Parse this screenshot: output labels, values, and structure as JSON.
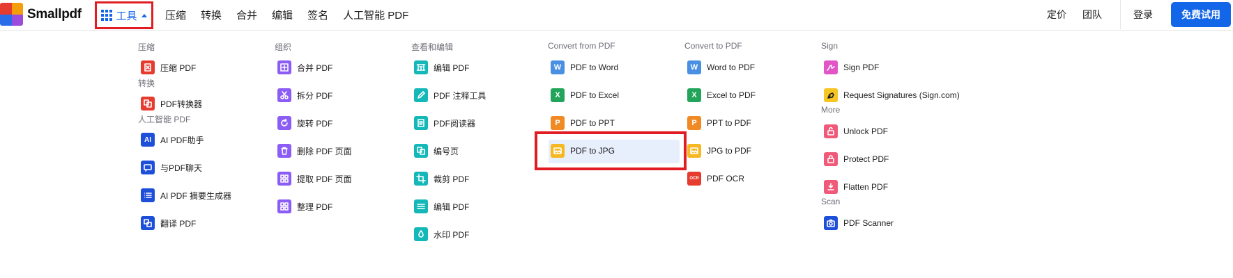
{
  "brand": {
    "name": "Smallpdf",
    "colors": [
      "#e53c2f",
      "#f59e0b",
      "#22a55a",
      "#2b6de8",
      "#9a4cdc"
    ]
  },
  "header": {
    "tools_label": "工具",
    "nav": [
      "压缩",
      "转换",
      "合并",
      "编辑",
      "签名",
      "人工智能 PDF"
    ],
    "pricing": "定价",
    "team": "团队",
    "login": "登录",
    "trial": "免费试用",
    "accent": "#1466e8"
  },
  "menu": {
    "columns": [
      {
        "sections": [
          {
            "title": "压缩",
            "items": [
              {
                "label": "压缩 PDF",
                "icon": "compress-icon",
                "color": "#e53c2f"
              }
            ]
          },
          {
            "title": "转换",
            "items": [
              {
                "label": "PDF转换器",
                "icon": "converter-icon",
                "color": "#e53c2f"
              }
            ]
          },
          {
            "title": "人工智能 PDF",
            "items": [
              {
                "label": "AI PDF助手",
                "icon": "ai-icon",
                "color": "#1d4fd8",
                "glyph": "AI"
              },
              {
                "label": "与PDF聊天",
                "icon": "chat-icon",
                "color": "#1d4fd8"
              },
              {
                "label": "AI PDF 摘要生成器",
                "icon": "list-icon",
                "color": "#1d4fd8"
              },
              {
                "label": "翻译 PDF",
                "icon": "translate-icon",
                "color": "#1d4fd8"
              }
            ]
          }
        ]
      },
      {
        "sections": [
          {
            "title": "组织",
            "items": [
              {
                "label": "合并 PDF",
                "icon": "merge-icon",
                "color": "#8b5cf6"
              },
              {
                "label": "拆分 PDF",
                "icon": "scissors-icon",
                "color": "#8b5cf6"
              },
              {
                "label": "旋转 PDF",
                "icon": "rotate-icon",
                "color": "#8b5cf6"
              },
              {
                "label": "删除 PDF 页面",
                "icon": "trash-icon",
                "color": "#8b5cf6"
              },
              {
                "label": "提取 PDF 页面",
                "icon": "extract-icon",
                "color": "#8b5cf6"
              },
              {
                "label": "整理 PDF",
                "icon": "organize-icon",
                "color": "#8b5cf6"
              }
            ]
          }
        ]
      },
      {
        "sections": [
          {
            "title": "查看和编辑",
            "items": [
              {
                "label": "编辑 PDF",
                "icon": "edit-frame-icon",
                "color": "#14b8b8"
              },
              {
                "label": "PDF 注释工具",
                "icon": "pen-icon",
                "color": "#14b8b8"
              },
              {
                "label": "PDF阅读器",
                "icon": "reader-icon",
                "color": "#14b8b8"
              },
              {
                "label": "编号页",
                "icon": "number-pages-icon",
                "color": "#14b8b8"
              },
              {
                "label": "裁剪 PDF",
                "icon": "crop-icon",
                "color": "#14b8b8"
              },
              {
                "label": "编辑 PDF",
                "icon": "form-icon",
                "color": "#14b8b8"
              },
              {
                "label": "水印 PDF",
                "icon": "watermark-icon",
                "color": "#14b8b8"
              }
            ]
          }
        ]
      },
      {
        "sections": [
          {
            "title": "Convert from PDF",
            "items": [
              {
                "label": "PDF to Word",
                "icon": "word-icon",
                "color": "#4a90e2",
                "glyph": "W"
              },
              {
                "label": "PDF to Excel",
                "icon": "excel-icon",
                "color": "#22a55a",
                "glyph": "X"
              },
              {
                "label": "PDF to PPT",
                "icon": "ppt-icon",
                "color": "#f08a24",
                "glyph": "P"
              },
              {
                "label": "PDF to JPG",
                "icon": "image-icon",
                "color": "#f6b822",
                "highlighted": true
              }
            ]
          }
        ]
      },
      {
        "sections": [
          {
            "title": "Convert to PDF",
            "items": [
              {
                "label": "Word to PDF",
                "icon": "word-icon",
                "color": "#4a90e2",
                "glyph": "W"
              },
              {
                "label": "Excel to PDF",
                "icon": "excel-icon",
                "color": "#22a55a",
                "glyph": "X"
              },
              {
                "label": "PPT to PDF",
                "icon": "ppt-icon",
                "color": "#f08a24",
                "glyph": "P"
              },
              {
                "label": "JPG to PDF",
                "icon": "image-icon",
                "color": "#f6b822"
              },
              {
                "label": "PDF OCR",
                "icon": "ocr-icon",
                "color": "#e53c2f",
                "glyph": "OCR"
              }
            ]
          }
        ]
      },
      {
        "sections": [
          {
            "title": "Sign",
            "items": [
              {
                "label": "Sign PDF",
                "icon": "signature-icon",
                "color": "#e255c7"
              },
              {
                "label": "Request Signatures (Sign.com)",
                "icon": "pen-nib-icon",
                "color": "#f6c623"
              }
            ]
          },
          {
            "title": "More",
            "items": [
              {
                "label": "Unlock PDF",
                "icon": "unlock-icon",
                "color": "#f05a78"
              },
              {
                "label": "Protect PDF",
                "icon": "lock-icon",
                "color": "#f05a78"
              },
              {
                "label": "Flatten PDF",
                "icon": "flatten-icon",
                "color": "#f05a78"
              }
            ]
          },
          {
            "title": "Scan",
            "items": [
              {
                "label": "PDF Scanner",
                "icon": "camera-icon",
                "color": "#1d4fd8"
              }
            ]
          }
        ]
      }
    ]
  }
}
